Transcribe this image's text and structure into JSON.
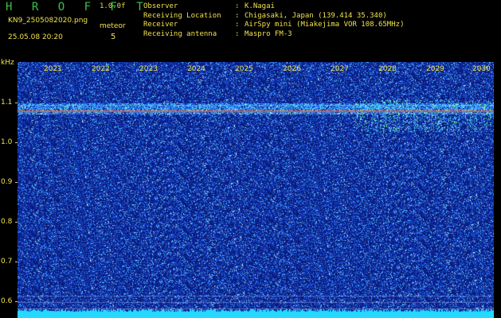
{
  "header": {
    "brand": "H R O F F T",
    "version": "1.0.0f",
    "filename": "KN9_2505082020.png",
    "meteor_label": "meteor",
    "datetime": "25.05.08 20:20",
    "meteor_count": "5",
    "info": [
      {
        "key": "Observer",
        "value": "K.Nagai"
      },
      {
        "key": "Receiving Location",
        "value": "Chigasaki, Japan (139.414 35.340)"
      },
      {
        "key": "Receiver",
        "value": "AirSpy mini (Miakejima VOR 108.65MHz)"
      },
      {
        "key": "Receiving antenna",
        "value": "Maspro FM-3"
      }
    ]
  },
  "spectrogram": {
    "y_unit": "kHz",
    "y_ticks": [
      "1.1",
      "1.0",
      "0.9",
      "0.8",
      "0.7",
      "0.6"
    ],
    "x_ticks": [
      "2021",
      "2022",
      "2023",
      "2024",
      "2025",
      "2026",
      "2027",
      "2028",
      "2029",
      "2030"
    ],
    "colors": {
      "background": "#0b1a7a",
      "signal_line": "#e04a3a",
      "base_band": "#25d9ff",
      "label": "#f0e24a"
    }
  }
}
